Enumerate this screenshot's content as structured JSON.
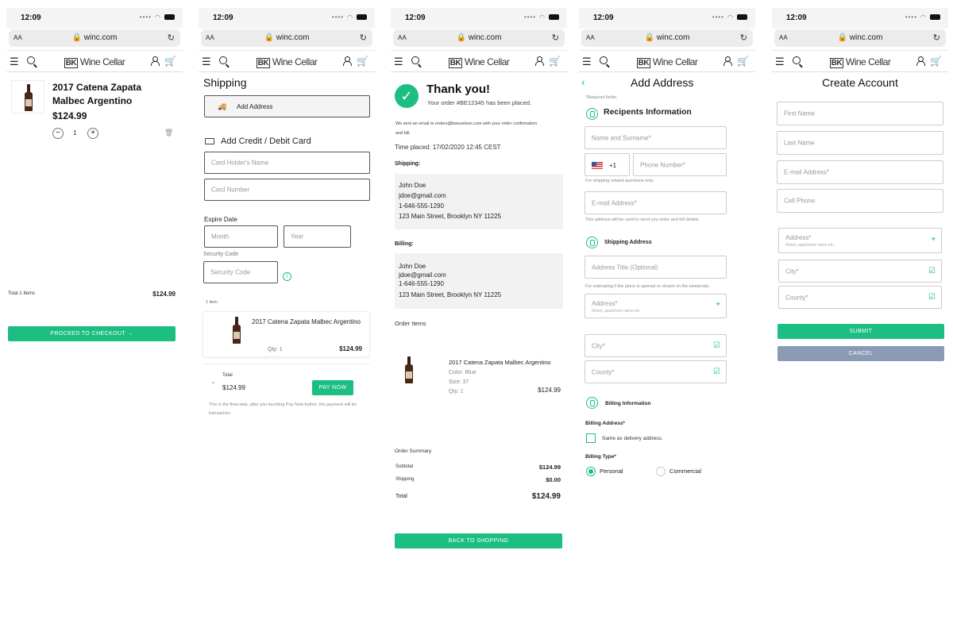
{
  "common": {
    "time": "12:09",
    "text_size": "AA",
    "url": "winc.com",
    "logo_mark": "BK",
    "logo_text": "Wine Cellar"
  },
  "cart": {
    "product_name_line1": "2017 Catena Zapata",
    "product_name_line2": "Malbec Argentino",
    "price": "$124.99",
    "qty": "1",
    "total_label": "Total 1 Items",
    "total_value": "$124.99",
    "checkout_label": "PROCEED TO CHECKOUT"
  },
  "shipping": {
    "title": "Shipping",
    "add_address": "Add Address",
    "card_title": "Add Credit / Debit Card",
    "holder_ph": "Card Holder's Name",
    "number_ph": "Card Number",
    "expire_label": "Expire Date",
    "month_ph": "Month",
    "year_ph": "Year",
    "security_label": "Security Code",
    "security_ph": "Security Code",
    "items_count": "1 item",
    "product": "2017 Catena Zapata Malbec Argentino",
    "qty": "Qty: 1",
    "price": "$124.99",
    "total_label": "Total",
    "total_value": "$124.99",
    "pay_now": "PAY NOW",
    "note": "This is the final step, after you touching Pay Now button, the payment will be transaction"
  },
  "thanks": {
    "title": "Thank you!",
    "order_line": "Your order #BE12345 has been placed.",
    "email_note": "We sent an email to orders@banuelson.com with your order confirmation and bill.",
    "time_placed": "Time placed: 17/02/2020 12:45 CEST",
    "shipping_label": "Shipping:",
    "ship_name": "John Doe",
    "ship_email": "jdoe@gmail.com",
    "ship_phone": "1-646-555-1290",
    "ship_street": "123 Main Street, Brooklyn NY 11225",
    "billing_label": "Billing:",
    "bill_name": "John Doe",
    "bill_email": "jdoe@gmail.com",
    "bill_phone": "1-646-555-1290",
    "bill_street": "123 Main Street, Brooklyn NY 11225",
    "order_items": "Order Items",
    "item_name": "2017 Catena Zapata Malbec Argentino",
    "item_color": "Color: Blue",
    "item_size": "Size: 37",
    "item_qty": "Qty: 1",
    "item_price": "$124.99",
    "summary_title": "Order Summary",
    "subtotal_label": "Subtotal",
    "subtotal_value": "$124.99",
    "shipping_cost_label": "Shipping",
    "shipping_cost_value": "$0.00",
    "total_label": "Total",
    "total_value": "$124.99",
    "back_button": "BACK TO SHOPPING"
  },
  "address": {
    "title": "Add Address",
    "required": "*Required fields.",
    "recipients_title": "Recipents Information",
    "name_ph": "Name and Surname*",
    "dial_code": "+1",
    "phone_ph": "Phone Number*",
    "phone_note": "For shipping related questions only.",
    "email_ph": "E-mail Address*",
    "email_note": "This address will be used to send you order and bill details.",
    "shipping_title": "Shipping Address",
    "addr_title_ph": "Address Title (Optional)",
    "addr_title_note": "For estimating if the place is opened or closed on the weekends.",
    "address_ph": "Address*",
    "address_sub": "Street, apartment name etc.",
    "city_ph": "City*",
    "county_ph": "County*",
    "billing_title": "Billing Information",
    "billing_addr_label": "Billing Address*",
    "same_as": "Same as delivery address.",
    "billing_type_label": "Billing Type*",
    "type_personal": "Personal",
    "type_commercial": "Commercial"
  },
  "account": {
    "title": "Create Account",
    "first_ph": "First Name",
    "last_ph": "Last Name",
    "email_ph": "E-mail Address*",
    "phone_ph": "Cell Phone",
    "address_ph": "Address*",
    "address_sub": "Street, apartment name etc.",
    "city_ph": "City*",
    "county_ph": "County*",
    "submit": "SUBMIT",
    "cancel": "CANCEL"
  },
  "colors": {
    "accent": "#1cbe82",
    "cancel": "#8a9bb6"
  }
}
